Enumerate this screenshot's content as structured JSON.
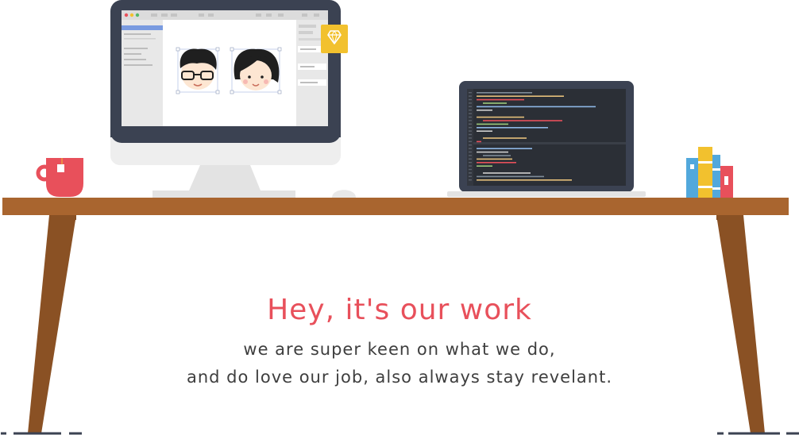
{
  "headline": "Hey, it's our work",
  "tagline_line1": "we are super keen on what we do,",
  "tagline_line2": "and do love our job, also always stay revelant.",
  "colors": {
    "accent_red": "#e8505b",
    "desk_wood": "#a9652f",
    "desk_leg": "#8a5124",
    "monitor_frame": "#3b4252",
    "laptop_screen": "#2b2f36",
    "sketch_badge": "#f2c12e"
  },
  "icons": [
    "sketch-diamond-icon",
    "tea-mug-icon",
    "books-icon",
    "avatar-boy-icon",
    "avatar-girl-icon"
  ]
}
